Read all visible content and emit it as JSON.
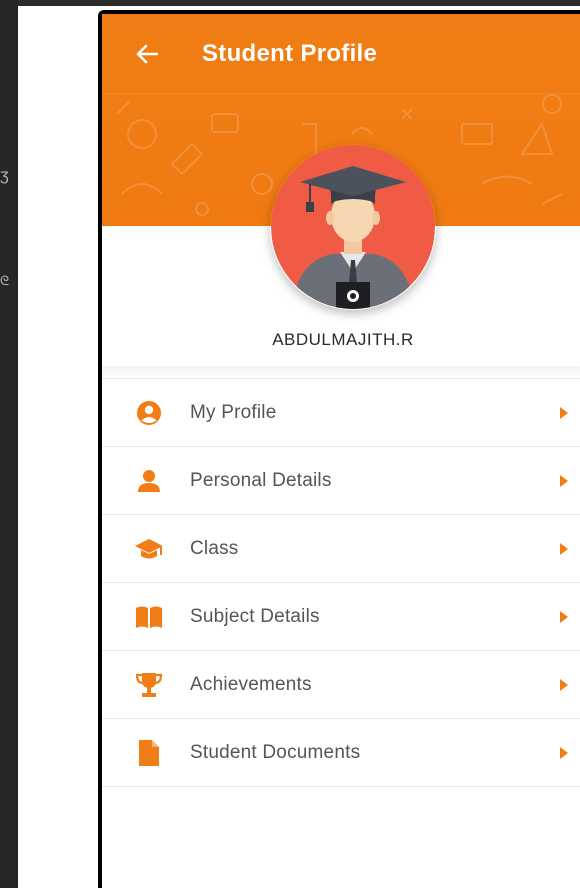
{
  "header": {
    "title": "Student Profile"
  },
  "profile": {
    "name": "ABDULMAJITH.R"
  },
  "menu": {
    "items": [
      {
        "label": "My Profile",
        "icon": "user-circle-icon"
      },
      {
        "label": "Personal Details",
        "icon": "user-icon"
      },
      {
        "label": "Class",
        "icon": "graduation-cap-icon"
      },
      {
        "label": "Subject Details",
        "icon": "book-icon"
      },
      {
        "label": "Achievements",
        "icon": "trophy-icon"
      },
      {
        "label": "Student Documents",
        "icon": "document-icon"
      }
    ]
  },
  "colors": {
    "accent": "#f07d15",
    "avatar_bg": "#ef5b45",
    "divider": "#e6e6e6",
    "label_text": "#555555",
    "backdrop": "#2b2b2b"
  }
}
